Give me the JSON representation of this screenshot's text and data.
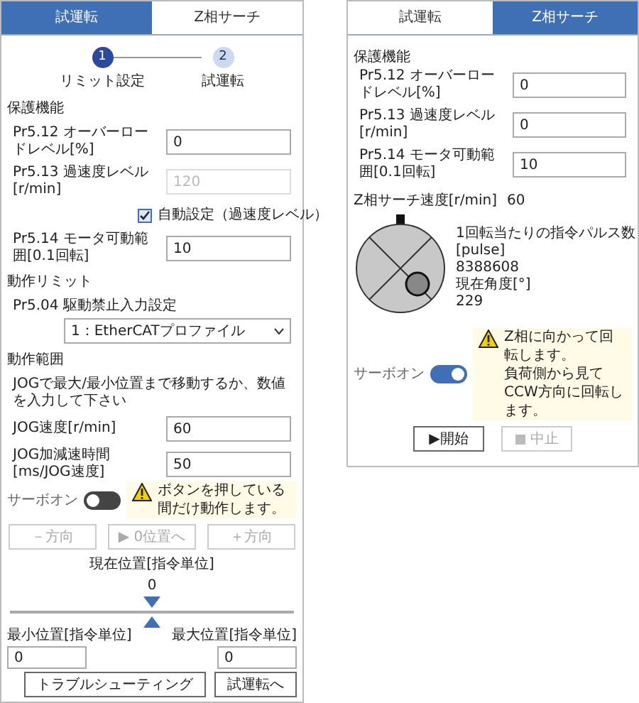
{
  "left": {
    "tabs": [
      {
        "label": "試運転",
        "selected": true
      },
      {
        "label": "Z相サーチ",
        "selected": false
      }
    ],
    "steps": [
      {
        "number": "1",
        "label": "リミット設定",
        "selected": true
      },
      {
        "number": "2",
        "label": "試運転",
        "selected": false
      }
    ],
    "rows": [
      {
        "kind": "heading",
        "text": "保護機能"
      },
      {
        "kind": "field",
        "label": "Pr5.12 オーバーロードレベル[%]",
        "value": "0",
        "disabled": false
      },
      {
        "kind": "field",
        "label": "Pr5.13 過速度レベル[r/min]",
        "value": "120",
        "disabled": true
      },
      {
        "kind": "checkbox",
        "label": "自動設定（過速度レベル）",
        "checked": true
      },
      {
        "kind": "field",
        "label": "Pr5.14 モータ可動範囲[0.1回転]",
        "value": "10",
        "disabled": false
      },
      {
        "kind": "heading",
        "text": "動作リミット"
      },
      {
        "kind": "select",
        "label": "Pr5.04 駆動禁止入力設定",
        "value": "1：EtherCATプロファイル"
      },
      {
        "kind": "heading",
        "text": "動作範囲"
      },
      {
        "kind": "note",
        "text": "JOGで最大/最小位置まで移動するか、数値を入力して下さい"
      },
      {
        "kind": "field",
        "label": "JOG速度[r/min]",
        "value": "60",
        "disabled": false
      },
      {
        "kind": "field",
        "label": "JOG加減速時間[ms/JOG速度]",
        "value": "50",
        "disabled": false
      }
    ],
    "servo": {
      "label": "サーボオン",
      "on": false
    },
    "warning": [
      "ボタンを押している間だけ動作します。"
    ],
    "jog_buttons": [
      {
        "label": "－方向",
        "disabled": true
      },
      {
        "label": "▶ 0位置へ",
        "disabled": true
      },
      {
        "label": "＋方向",
        "disabled": true
      }
    ],
    "position": {
      "label": "現在位置[指令単位]",
      "value": "0",
      "level": 0.5
    },
    "min": {
      "label": "最小位置[指令単位]",
      "value": "0"
    },
    "max": {
      "label": "最大位置[指令単位]",
      "value": "0"
    },
    "footer_buttons": [
      "トラブルシューティング",
      "試運転へ"
    ]
  },
  "right": {
    "tabs": [
      {
        "label": "試運転",
        "selected": false
      },
      {
        "label": "Z相サーチ",
        "selected": true
      }
    ],
    "heading": "保護機能",
    "fields": [
      {
        "label": "Pr5.12 オーバーロードレベル[%]",
        "value": "0"
      },
      {
        "label": "Pr5.13 過速度レベル[r/min]",
        "value": "0"
      },
      {
        "label": "Pr5.14 モータ可動範囲[0.1回転]",
        "value": "10"
      }
    ],
    "speed": {
      "label": "Z相サーチ速度[r/min]",
      "value": "60"
    },
    "info": [
      {
        "label": "1回転当たりの指令パルス数[pulse]",
        "value": "8388608"
      },
      {
        "label": "現在角度[°]",
        "value": "229"
      }
    ],
    "servo": {
      "label": "サーボオン",
      "on": true
    },
    "warning": [
      "Z相に向かって回転します。",
      "負荷側から見てCCW方向に回転します。"
    ],
    "buttons": [
      {
        "kind": "start",
        "label": "▶開始",
        "disabled": false
      },
      {
        "kind": "stop",
        "label": "中止",
        "disabled": true
      }
    ]
  }
}
